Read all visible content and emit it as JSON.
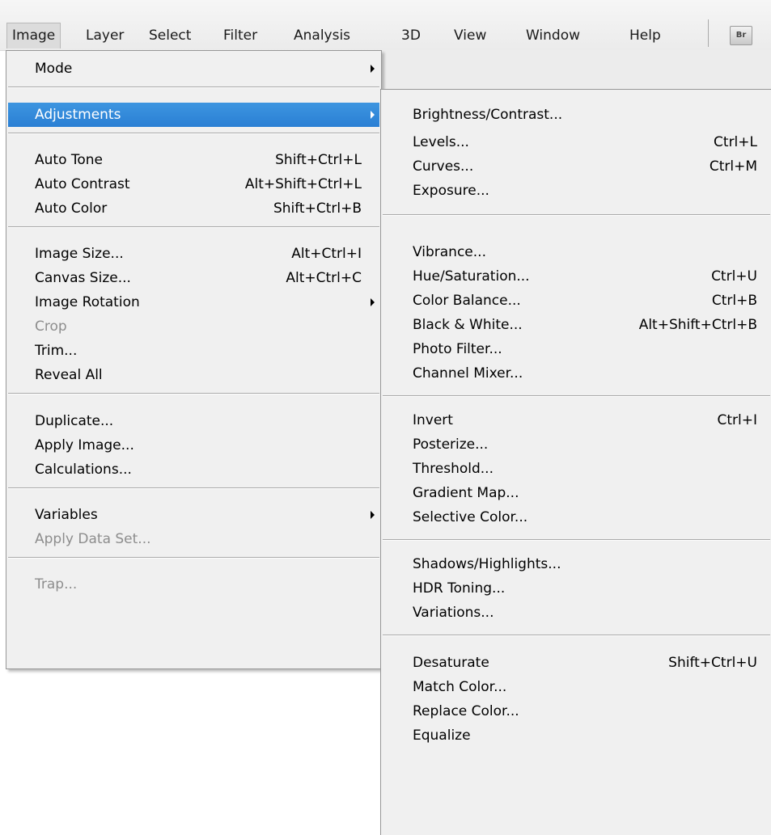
{
  "menubar": {
    "items": [
      "Image",
      "Layer",
      "Select",
      "Filter",
      "Analysis",
      "3D",
      "View",
      "Window",
      "Help"
    ],
    "bridge_label": "Br"
  },
  "image_menu": {
    "items": [
      {
        "label": "Mode",
        "submenu": true
      },
      {
        "label": "Adjustments",
        "submenu": true,
        "highlighted": true
      },
      {
        "label": "Auto Tone",
        "shortcut": "Shift+Ctrl+L"
      },
      {
        "label": "Auto Contrast",
        "shortcut": "Alt+Shift+Ctrl+L"
      },
      {
        "label": "Auto Color",
        "shortcut": "Shift+Ctrl+B"
      },
      {
        "label": "Image Size...",
        "shortcut": "Alt+Ctrl+I"
      },
      {
        "label": "Canvas Size...",
        "shortcut": "Alt+Ctrl+C"
      },
      {
        "label": "Image Rotation",
        "submenu": true
      },
      {
        "label": "Crop",
        "disabled": true
      },
      {
        "label": "Trim..."
      },
      {
        "label": "Reveal All"
      },
      {
        "label": "Duplicate..."
      },
      {
        "label": "Apply Image..."
      },
      {
        "label": "Calculations..."
      },
      {
        "label": "Variables",
        "submenu": true
      },
      {
        "label": "Apply Data Set...",
        "disabled": true
      },
      {
        "label": "Trap...",
        "disabled": true
      }
    ]
  },
  "adjustments_menu": {
    "items": [
      {
        "label": "Brightness/Contrast..."
      },
      {
        "label": "Levels...",
        "shortcut": "Ctrl+L"
      },
      {
        "label": "Curves...",
        "shortcut": "Ctrl+M"
      },
      {
        "label": "Exposure..."
      },
      {
        "label": "Vibrance..."
      },
      {
        "label": "Hue/Saturation...",
        "shortcut": "Ctrl+U"
      },
      {
        "label": "Color Balance...",
        "shortcut": "Ctrl+B"
      },
      {
        "label": "Black & White...",
        "shortcut": "Alt+Shift+Ctrl+B"
      },
      {
        "label": "Photo Filter..."
      },
      {
        "label": "Channel Mixer..."
      },
      {
        "label": "Invert",
        "shortcut": "Ctrl+I"
      },
      {
        "label": "Posterize..."
      },
      {
        "label": "Threshold..."
      },
      {
        "label": "Gradient Map..."
      },
      {
        "label": "Selective Color..."
      },
      {
        "label": "Shadows/Highlights..."
      },
      {
        "label": "HDR Toning..."
      },
      {
        "label": "Variations..."
      },
      {
        "label": "Desaturate",
        "shortcut": "Shift+Ctrl+U"
      },
      {
        "label": "Match Color..."
      },
      {
        "label": "Replace Color..."
      },
      {
        "label": "Equalize"
      }
    ]
  },
  "colors": {
    "highlight": "#2a7fd4",
    "menu_bg": "#f0f0f0",
    "disabled_text": "#8d8d8d"
  }
}
